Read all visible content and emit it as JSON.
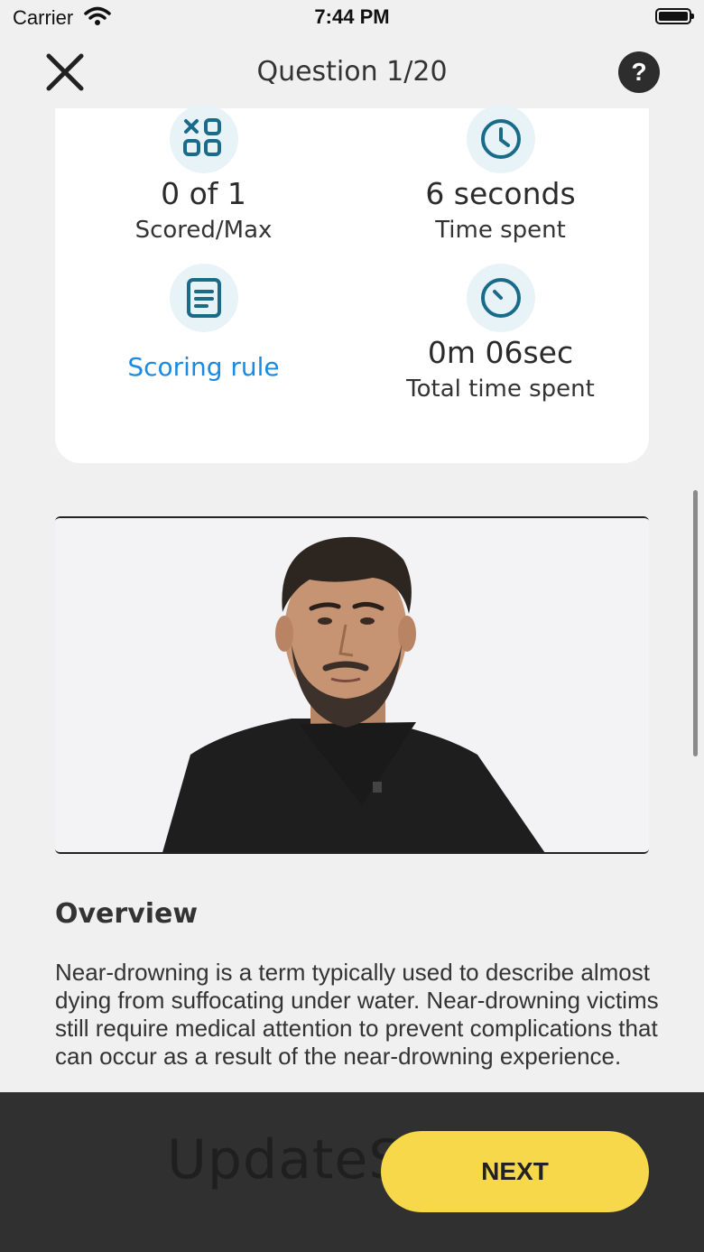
{
  "status_bar": {
    "carrier": "Carrier",
    "time": "7:44 PM"
  },
  "nav": {
    "title": "Question 1/20",
    "help_label": "?"
  },
  "stats": {
    "score": {
      "value": "0 of 1",
      "label": "Scored/Max"
    },
    "time_spent": {
      "value": "6 seconds",
      "label": "Time spent"
    },
    "scoring_rule": {
      "label": "Scoring rule"
    },
    "total_time": {
      "value": "0m 06sec",
      "label": "Total time spent"
    }
  },
  "overview": {
    "title": "Overview",
    "text": "Near-drowning is a term typically used to describe almost dying from suffocating under water. Near-drowning victims still require medical attention to prevent complications that can occur as a result of the near-drowning experience."
  },
  "bottom": {
    "watermark": "UpdateStar.com",
    "next_label": "NEXT"
  },
  "colors": {
    "accent_yellow": "#f6d84a",
    "link_blue": "#1b8ae0",
    "icon_teal": "#1a6a8a",
    "bottom_bar": "#303030"
  }
}
